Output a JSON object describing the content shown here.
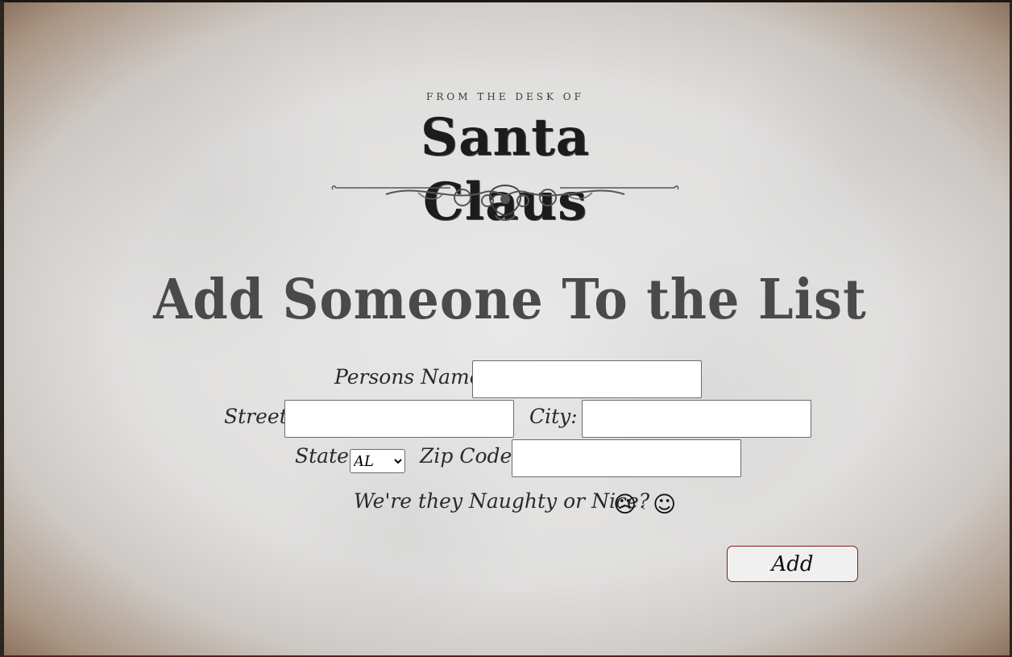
{
  "letterhead": {
    "from_desk": "FROM THE DESK OF",
    "name": "Santa Claus"
  },
  "form": {
    "heading": "Add Someone To the List",
    "name_label": "Persons Name:",
    "name_value": "",
    "street_label": "Street:",
    "street_value": "",
    "city_label": "City:",
    "city_value": "",
    "state_label": "State:",
    "state_selected": "AL",
    "zip_label": "Zip Code:",
    "zip_value": "",
    "naughty_nice_label": "We're they Naughty or Nice?",
    "naughty_icon": "frowning-face-icon",
    "nice_icon": "smiling-face-icon",
    "add_button": "Add"
  }
}
